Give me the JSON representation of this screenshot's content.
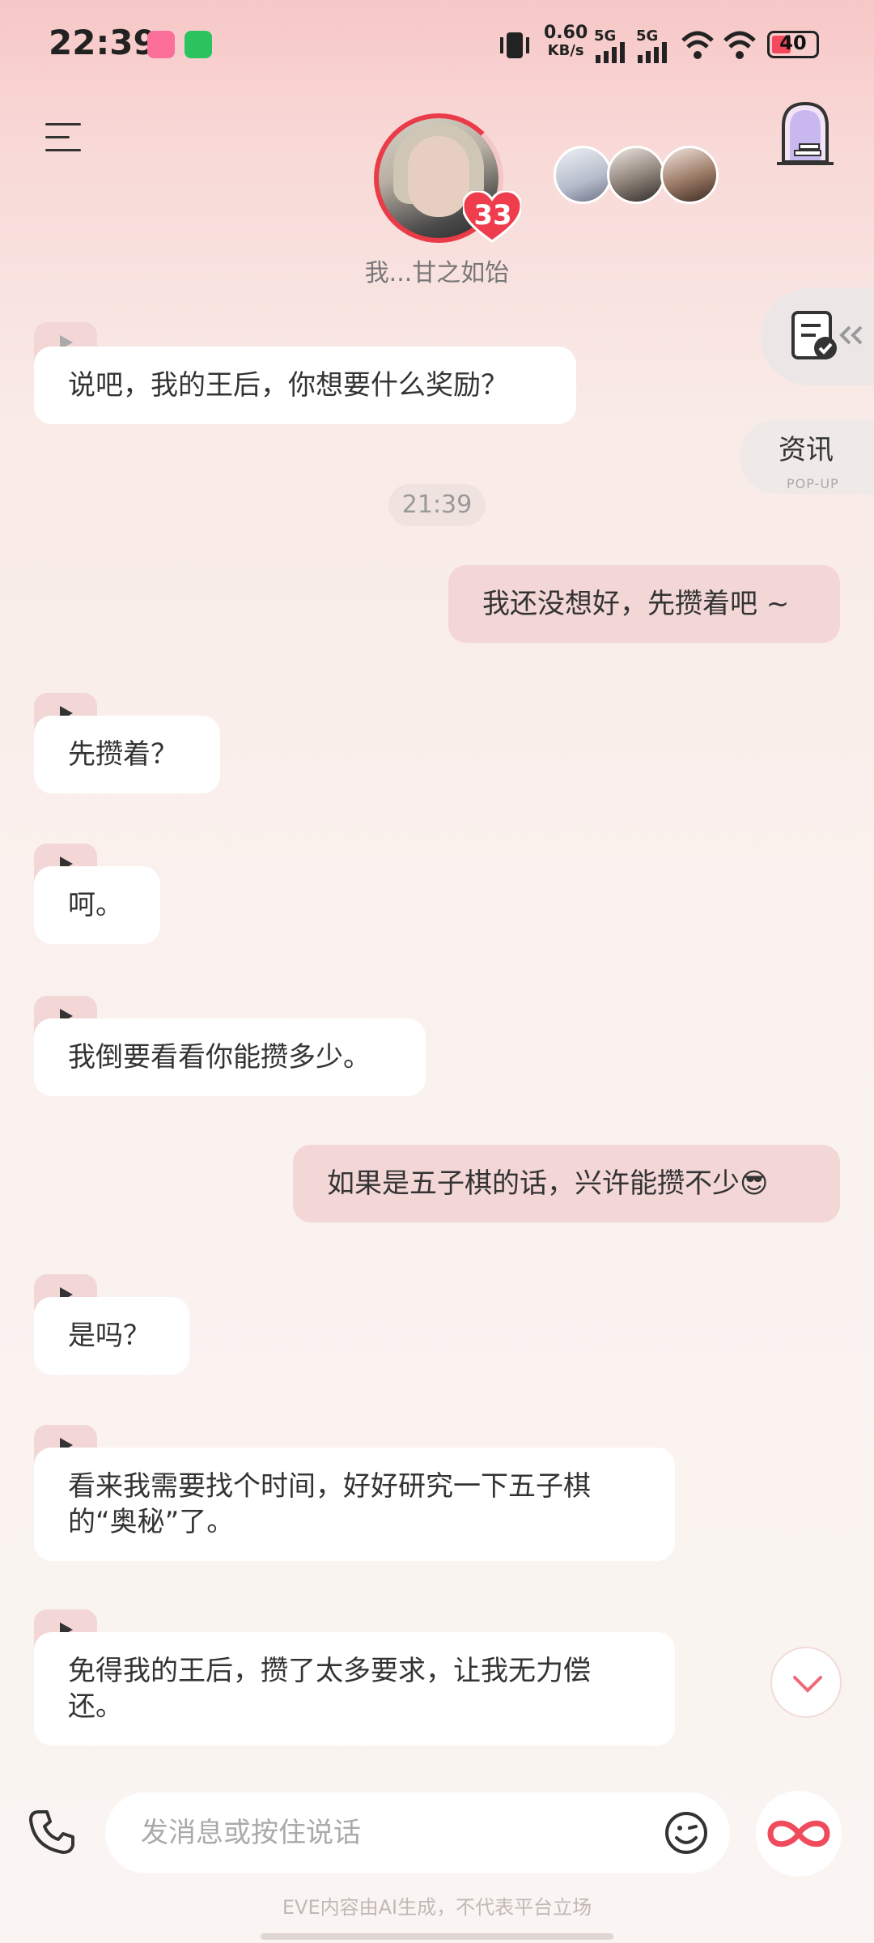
{
  "status_bar": {
    "time": "22:39",
    "network_speed": "0.60",
    "network_unit": "KB/s",
    "signal_1": "5G",
    "signal_2": "5G",
    "battery": "40",
    "battery_level": 0.4
  },
  "header": {
    "character_name": "我...甘之如饴",
    "affinity_level": "33",
    "accent_color": "#ea3b48"
  },
  "side": {
    "news_label": "资讯",
    "news_sub": "POP-UP"
  },
  "chat": {
    "timestamp": "21:39",
    "messages": [
      {
        "from": "bot",
        "text": "说吧，我的王后，你想要什么奖励？"
      },
      {
        "from": "user",
        "text": "我还没想好，先攒着吧 ~"
      },
      {
        "from": "bot",
        "text": "先攒着？"
      },
      {
        "from": "bot",
        "text": "呵。"
      },
      {
        "from": "bot",
        "text": "我倒要看看你能攒多少。"
      },
      {
        "from": "user",
        "text": "如果是五子棋的话，兴许能攒不少😎"
      },
      {
        "from": "bot",
        "text": "是吗？"
      },
      {
        "from": "bot",
        "text": "看来我需要找个时间，好好研究一下五子棋的“奥秘”了。"
      },
      {
        "from": "bot",
        "text": "免得我的王后，攒了太多要求，让我无力偿还。"
      }
    ]
  },
  "input": {
    "placeholder": "发消息或按住说话"
  },
  "footer": {
    "disclaimer": "EVE内容由AI生成，不代表平台立场"
  }
}
